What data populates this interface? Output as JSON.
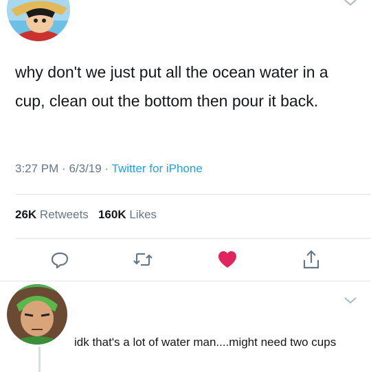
{
  "tweet": {
    "text": "why don't we just put all the ocean water in a cup, clean out the bottom then pour it back.",
    "time": "3:27 PM",
    "date": "6/3/19",
    "source": "Twitter for iPhone",
    "retweets_count": "26K",
    "retweets_label": "Retweets",
    "likes_count": "160K",
    "likes_label": "Likes"
  },
  "reply": {
    "text": "idk that's a lot of water man....might need two cups"
  },
  "colors": {
    "link": "#1da1f2",
    "muted": "#657786",
    "heart": "#e0245e",
    "divider": "#e1e8ed"
  },
  "icons": [
    "chevron-down-icon",
    "reply-icon",
    "retweet-icon",
    "heart-icon",
    "share-icon"
  ]
}
